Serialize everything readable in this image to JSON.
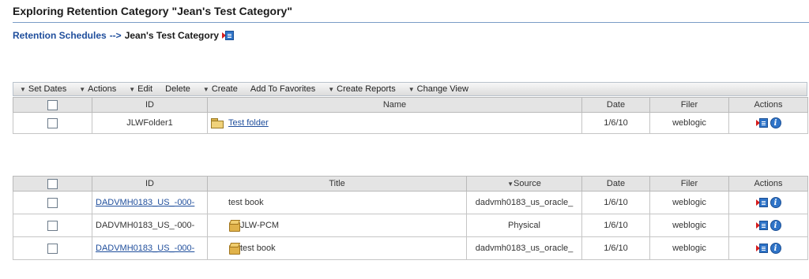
{
  "page": {
    "title": "Exploring Retention Category \"Jean's Test Category\""
  },
  "breadcrumb": {
    "link": "Retention Schedules",
    "separator": "-->",
    "current": "Jean's Test Category",
    "actions_icon": "actions-menu-icon"
  },
  "toolbar": {
    "items": [
      {
        "label": "Set Dates",
        "dropdown": true
      },
      {
        "label": "Actions",
        "dropdown": true
      },
      {
        "label": "Edit",
        "dropdown": true
      },
      {
        "label": "Delete",
        "dropdown": false
      },
      {
        "label": "Create",
        "dropdown": true
      },
      {
        "label": "Add To Favorites",
        "dropdown": false
      },
      {
        "label": "Create Reports",
        "dropdown": true
      },
      {
        "label": "Change View",
        "dropdown": true
      }
    ]
  },
  "folders_table": {
    "headers": {
      "id": "ID",
      "name": "Name",
      "date": "Date",
      "filer": "Filer",
      "actions": "Actions"
    },
    "rows": [
      {
        "id": "JLWFolder1",
        "name": "Test folder",
        "date": "1/6/10",
        "filer": "weblogic"
      }
    ]
  },
  "items_table": {
    "headers": {
      "id": "ID",
      "title": "Title",
      "source": "Source",
      "date": "Date",
      "filer": "Filer",
      "actions": "Actions"
    },
    "rows": [
      {
        "id": "DADVMH0183_US_-000-",
        "title": "test book",
        "source": "dadvmh0183_us_oracle_",
        "date": "1/6/10",
        "filer": "weblogic",
        "id_link": true,
        "icon": ""
      },
      {
        "id": "DADVMH0183_US_-000-",
        "title": "JLW-PCM",
        "source": "Physical",
        "date": "1/6/10",
        "filer": "weblogic",
        "id_link": false,
        "icon": "package-icon"
      },
      {
        "id": "DADVMH0183_US_-000-",
        "title": "test book",
        "source": "dadvmh0183_us_oracle_",
        "date": "1/6/10",
        "filer": "weblogic",
        "id_link": true,
        "icon": "package-icon"
      }
    ]
  },
  "colors": {
    "link": "#1f4e9c",
    "header_bg": "#e4e4e4",
    "title_rule": "#7a9cc6"
  }
}
